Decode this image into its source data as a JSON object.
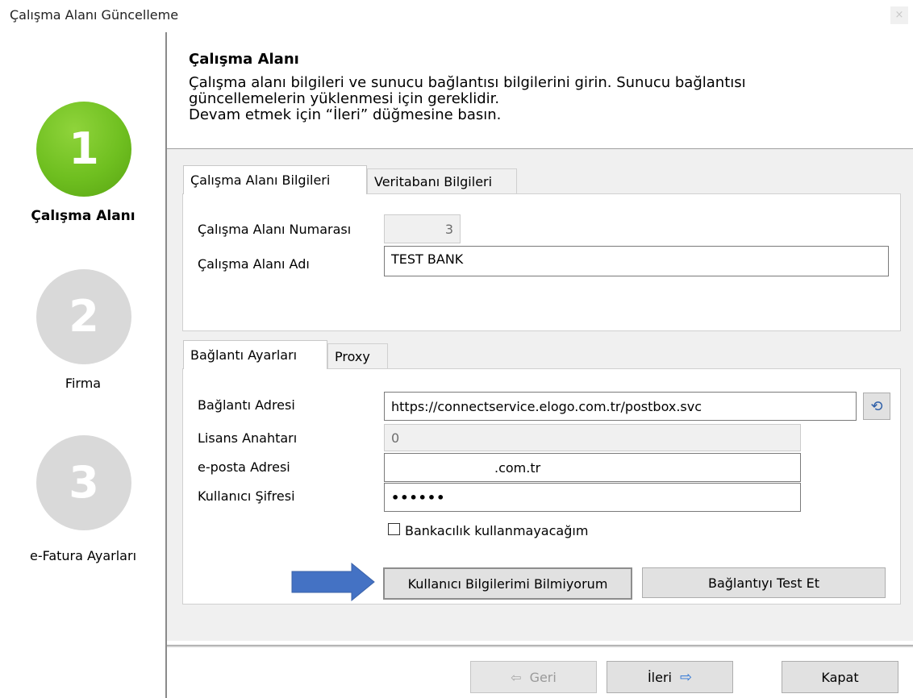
{
  "window": {
    "title": "Çalışma Alanı Güncelleme",
    "close_glyph": "×"
  },
  "steps": [
    {
      "number": "1",
      "label": "Çalışma Alanı",
      "state": "active",
      "color": "#6fbf20"
    },
    {
      "number": "2",
      "label": "Firma",
      "state": "inactive",
      "color": "#d9d9d9"
    },
    {
      "number": "3",
      "label": "e-Fatura Ayarları",
      "state": "inactive",
      "color": "#d9d9d9"
    }
  ],
  "header": {
    "title": "Çalışma Alanı",
    "description_lines": [
      "Çalışma alanı bilgileri ve sunucu bağlantısı bilgilerini girin. Sunucu bağlantısı",
      "güncellemelerin yüklenmesi için gereklidir.",
      "Devam etmek için “İleri” düğmesine basın."
    ]
  },
  "workspace_tabs": [
    {
      "label": "Çalışma Alanı Bilgileri",
      "active": true
    },
    {
      "label": "Veritabanı Bilgileri",
      "active": false
    }
  ],
  "workspace": {
    "number_label": "Çalışma Alanı Numarası",
    "number_value": "3",
    "name_label": "Çalışma Alanı Adı",
    "name_value": "TEST BANK"
  },
  "connection_tabs": [
    {
      "label": "Bağlantı Ayarları",
      "active": true
    },
    {
      "label": "Proxy",
      "active": false
    }
  ],
  "connection": {
    "address_label": "Bağlantı Adresi",
    "address_value": "https://connectservice.elogo.com.tr/postbox.svc",
    "reset_icon": "undo-icon",
    "license_label": "Lisans Anahtarı",
    "license_value": "0",
    "email_label": "e-posta Adresi",
    "email_value": ".com.tr",
    "password_label": "Kullanıcı Şifresi",
    "password_value": "••••••",
    "no_banking_label": "Bankacılık kullanmayacağım",
    "no_banking_checked": false,
    "forgot_button": "Kullanıcı Bilgilerimi Bilmiyorum",
    "test_button": "Bağlantıyı Test Et",
    "arrow_color": "#4472c4"
  },
  "footer": {
    "back_label": "Geri",
    "next_label": "İleri",
    "close_label": "Kapat",
    "arrow_color": "#2e75d6"
  }
}
